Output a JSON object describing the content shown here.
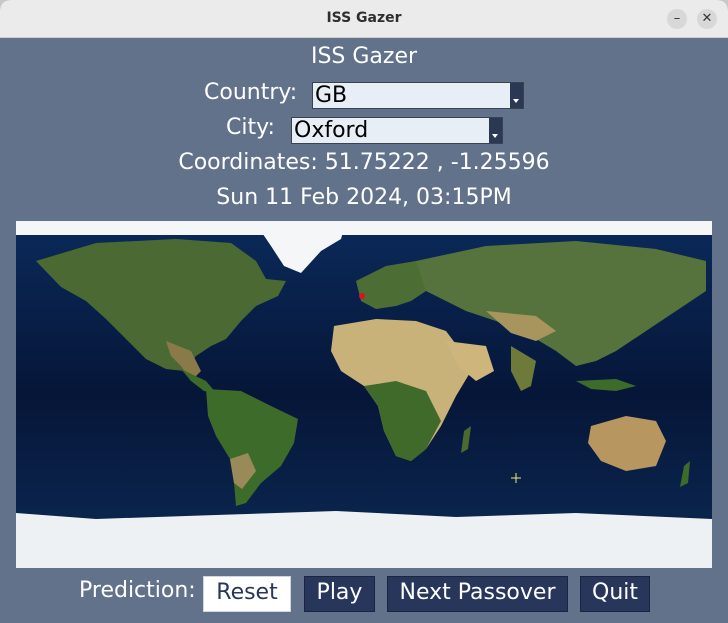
{
  "window": {
    "title": "ISS Gazer"
  },
  "app": {
    "title": "ISS Gazer",
    "country_label": "Country:",
    "country_value": "GB",
    "city_label": "City:",
    "city_value": "Oxford",
    "coordinates_text": "Coordinates:  51.75222  , -1.25596",
    "datetime_text": "Sun 11 Feb 2024, 03:15PM"
  },
  "map": {
    "marker_color": "#e01020",
    "iss_marker_color": "#f0f070",
    "ocean_color": "#061433"
  },
  "controls": {
    "prediction_label": "Prediction:",
    "reset_label": "Reset",
    "play_label": "Play",
    "next_passover_label": "Next Passover",
    "quit_label": "Quit"
  },
  "colors": {
    "background": "#62728a",
    "button": "#27365a",
    "button_text": "#ffffff"
  }
}
